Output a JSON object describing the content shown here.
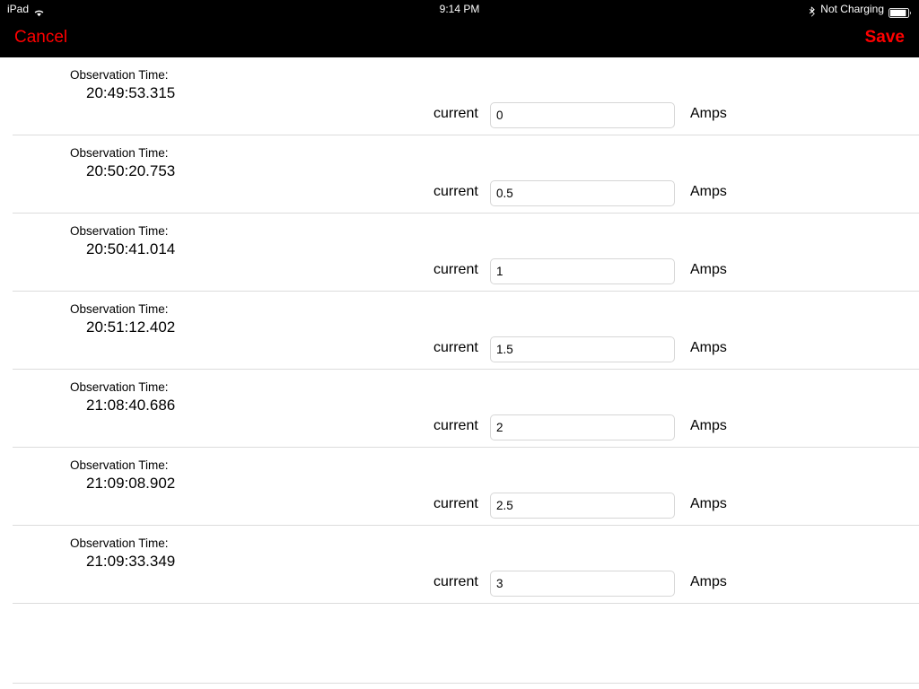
{
  "statusbar": {
    "device_name": "iPad",
    "wifi_icon": "wifi-icon",
    "time": "9:14 PM",
    "bluetooth_icon": "bluetooth-icon",
    "charging_status": "Not Charging",
    "battery_icon": "battery-icon"
  },
  "navbar": {
    "cancel_label": "Cancel",
    "save_label": "Save",
    "background_color": "#000000",
    "button_color": "#ff0000"
  },
  "table": {
    "observation_label": "Observation Time:",
    "current_label": "current",
    "units_label": "Amps",
    "rows": [
      {
        "observation_label": "Observation Time:",
        "time": "20:49:53.315",
        "current_label": "current",
        "current_value": "0",
        "units": "Amps"
      },
      {
        "observation_label": "Observation Time:",
        "time": "20:50:20.753",
        "current_label": "current",
        "current_value": "0.5",
        "units": "Amps"
      },
      {
        "observation_label": "Observation Time:",
        "time": "20:50:41.014",
        "current_label": "current",
        "current_value": "1",
        "units": "Amps"
      },
      {
        "observation_label": "Observation Time:",
        "time": "20:51:12.402",
        "current_label": "current",
        "current_value": "1.5",
        "units": "Amps"
      },
      {
        "observation_label": "Observation Time:",
        "time": "21:08:40.686",
        "current_label": "current",
        "current_value": "2",
        "units": "Amps"
      },
      {
        "observation_label": "Observation Time:",
        "time": "21:09:08.902",
        "current_label": "current",
        "current_value": "2.5",
        "units": "Amps"
      },
      {
        "observation_label": "Observation Time:",
        "time": "21:09:33.349",
        "current_label": "current",
        "current_value": "3",
        "units": "Amps"
      }
    ]
  }
}
